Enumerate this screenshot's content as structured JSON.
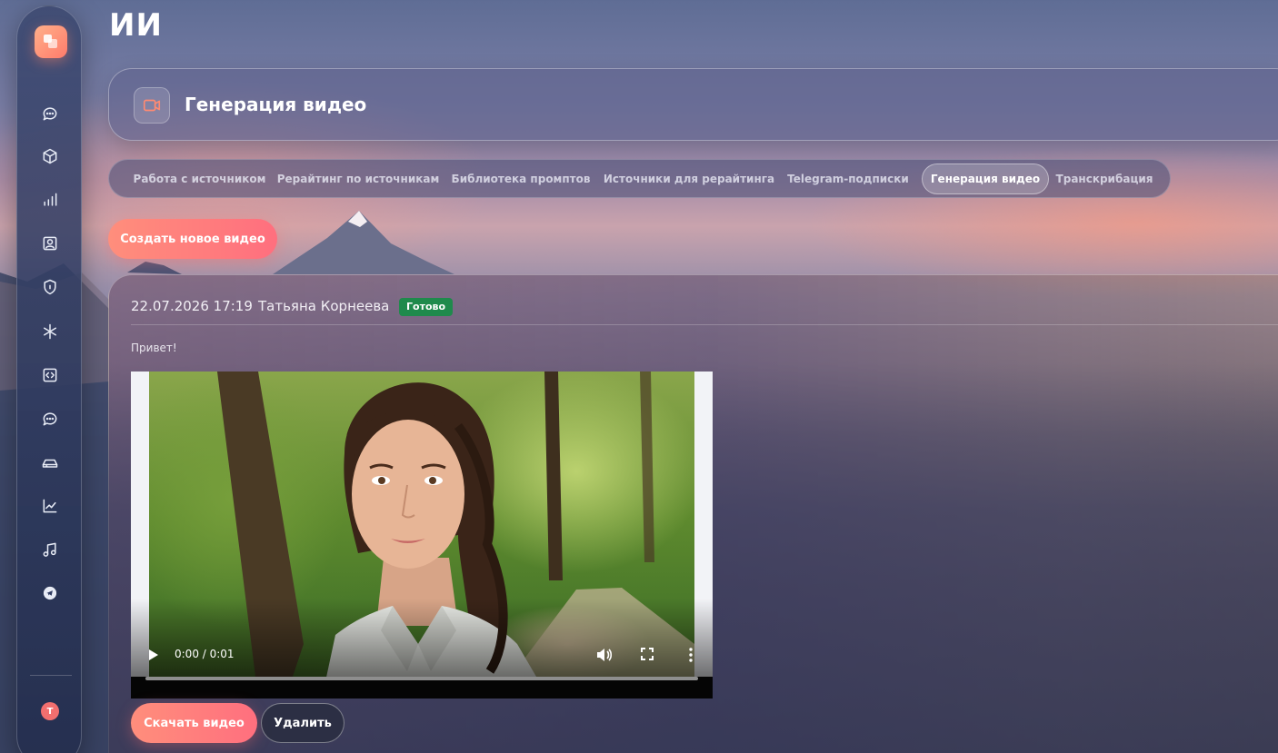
{
  "page": {
    "title": "ИИ"
  },
  "sidebar": {
    "logo_icon": "app-logo-icon",
    "items": [
      {
        "icon": "chat-bubble-icon"
      },
      {
        "icon": "cube-icon"
      },
      {
        "icon": "bar-chart-icon"
      },
      {
        "icon": "contact-card-icon"
      },
      {
        "icon": "shield-icon"
      },
      {
        "icon": "asterisk-icon"
      },
      {
        "icon": "code-icon"
      },
      {
        "icon": "chat-bubble-icon"
      },
      {
        "icon": "drive-icon"
      },
      {
        "icon": "trend-chart-icon"
      },
      {
        "icon": "music-note-icon"
      },
      {
        "icon": "telegram-icon"
      }
    ],
    "avatar_initial": "Т"
  },
  "header": {
    "icon": "video-camera-icon",
    "title": "Генерация видео"
  },
  "tabs": [
    {
      "label": "Работа с источником",
      "active": false
    },
    {
      "label": "Рерайтинг по источникам",
      "active": false
    },
    {
      "label": "Библиотека промптов",
      "active": false
    },
    {
      "label": "Источники для рерайтинга",
      "active": false
    },
    {
      "label": "Telegram-подписки",
      "active": false
    },
    {
      "label": "Генерация видео",
      "active": true
    },
    {
      "label": "Транскрибация",
      "active": false
    }
  ],
  "actions": {
    "create_label": "Создать новое видео"
  },
  "video_card": {
    "date": "22.07.2026 17:19",
    "author": "Татьяна Корнеева",
    "status": "Готово",
    "status_color": "#1f8a4c",
    "prompt": "Привет!",
    "player": {
      "time": "0:00 / 0:01",
      "progress": 0
    },
    "download_label": "Скачать видео",
    "delete_label": "Удалить"
  },
  "colors": {
    "accent": "#ff7b7b",
    "sidebar": "#2e3a60"
  }
}
